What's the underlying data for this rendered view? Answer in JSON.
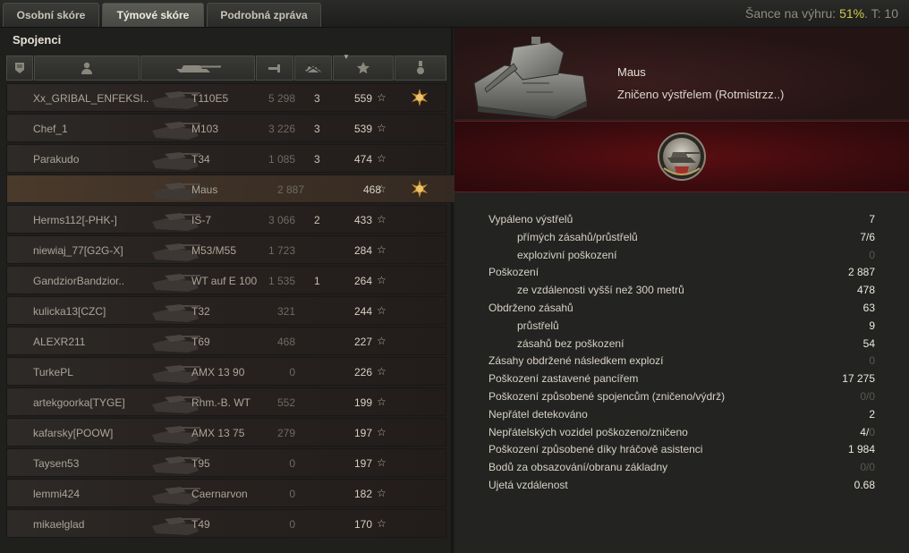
{
  "tabs": [
    {
      "label": "Osobní skóre",
      "active": false
    },
    {
      "label": "Týmové skóre",
      "active": true
    },
    {
      "label": "Podrobná zpráva",
      "active": false
    }
  ],
  "chance": {
    "label": "Šance na výhru:",
    "percent": "51%",
    "tier": ". T: 10"
  },
  "team": {
    "title": "Spojenci",
    "columns": [
      "squad-icon",
      "player-icon",
      "tank-icon",
      "damage-icon",
      "kills-icon",
      "xp-star-icon",
      "medal-icon"
    ],
    "rows": [
      {
        "name": "Xx_GRIBAL_ENFEKSI..",
        "tank": "T110E5",
        "damage": "5 298",
        "kills": "3",
        "xp": "559",
        "medal": true,
        "self": false
      },
      {
        "name": "Chef_1",
        "tank": "M103",
        "damage": "3 226",
        "kills": "3",
        "xp": "539",
        "medal": false,
        "self": false
      },
      {
        "name": "Parakudo",
        "tank": "T34",
        "damage": "1 085",
        "kills": "3",
        "xp": "474",
        "medal": false,
        "self": false
      },
      {
        "name": "",
        "tank": "Maus",
        "damage": "2 887",
        "kills": "",
        "xp": "468",
        "medal": true,
        "self": true
      },
      {
        "name": "Herms112[-PHK-]",
        "tank": "IS-7",
        "damage": "3 066",
        "kills": "2",
        "xp": "433",
        "medal": false,
        "self": false
      },
      {
        "name": "niewiaj_77[G2G-X]",
        "tank": "M53/M55",
        "damage": "1 723",
        "kills": "",
        "xp": "284",
        "medal": false,
        "self": false
      },
      {
        "name": "GandziorBandzior..",
        "tank": "WT auf E 100",
        "damage": "1 535",
        "kills": "1",
        "xp": "264",
        "medal": false,
        "self": false
      },
      {
        "name": "kulicka13[CZC]",
        "tank": "T32",
        "damage": "321",
        "kills": "",
        "xp": "244",
        "medal": false,
        "self": false
      },
      {
        "name": "ALEXR211",
        "tank": "T69",
        "damage": "468",
        "kills": "",
        "xp": "227",
        "medal": false,
        "self": false
      },
      {
        "name": "TurkePL",
        "tank": "AMX 13 90",
        "damage": "0",
        "kills": "",
        "xp": "226",
        "medal": false,
        "self": false
      },
      {
        "name": "artekgoorka[TYGE]",
        "tank": "Rhm.-B. WT",
        "damage": "552",
        "kills": "",
        "xp": "199",
        "medal": false,
        "self": false
      },
      {
        "name": "kafarsky[POOW]",
        "tank": "AMX 13 75",
        "damage": "279",
        "kills": "",
        "xp": "197",
        "medal": false,
        "self": false
      },
      {
        "name": "Taysen53",
        "tank": "T95",
        "damage": "0",
        "kills": "",
        "xp": "197",
        "medal": false,
        "self": false
      },
      {
        "name": "lemmi424",
        "tank": "Caernarvon",
        "damage": "0",
        "kills": "",
        "xp": "182",
        "medal": false,
        "self": false
      },
      {
        "name": "mikaelglad",
        "tank": "T49",
        "damage": "0",
        "kills": "",
        "xp": "170",
        "medal": false,
        "self": false
      }
    ]
  },
  "vehicle": {
    "name": "Maus",
    "status": "Zničeno výstřelem (Rotmistrzz..)"
  },
  "stats": [
    {
      "label": "Vypáleno výstřelů",
      "value": "7",
      "sub": false
    },
    {
      "label": "přímých zásahů/průstřelů",
      "value": "7/6",
      "sub": true
    },
    {
      "label": "explozivní poškození",
      "value": "0",
      "sub": true,
      "dim": true
    },
    {
      "label": "Poškození",
      "value": "2 887",
      "sub": false
    },
    {
      "label": "ze vzdálenosti vyšší než 300 metrů",
      "value": "478",
      "sub": true
    },
    {
      "label": "Obdrženo zásahů",
      "value": "63",
      "sub": false
    },
    {
      "label": "průstřelů",
      "value": "9",
      "sub": true
    },
    {
      "label": "zásahů bez poškození",
      "value": "54",
      "sub": true
    },
    {
      "label": "Zásahy obdržené následkem explozí",
      "value": "0",
      "sub": false,
      "dim": true
    },
    {
      "label": "Poškození zastavené pancířem",
      "value": "17 275",
      "sub": false
    },
    {
      "label": "Poškození způsobené spojencům (zničeno/výdrž)",
      "value": "0/0",
      "sub": false,
      "dim": true
    },
    {
      "label": "Nepřátel detekováno",
      "value": "2",
      "sub": false
    },
    {
      "label": "Nepřátelských vozidel poškozeno/zničeno",
      "value_main": "4/",
      "value_dim": "0",
      "sub": false
    },
    {
      "label": "Poškození způsobené díky hráčově asistenci",
      "value": "1 984",
      "sub": false
    },
    {
      "label": "Bodů za obsazování/obranu základny",
      "value": "0/0",
      "sub": false,
      "dim": true
    },
    {
      "label": "Ujetá vzdálenost",
      "value": "0.68",
      "sub": false
    }
  ]
}
